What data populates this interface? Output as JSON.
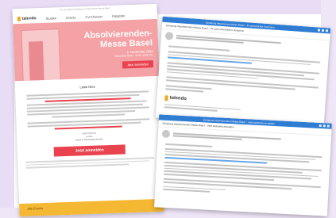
{
  "newsletter": {
    "preheader": "Ihre persönliche Einladung zur Absolventen-Messe Basel",
    "brand": "talendo",
    "nav": [
      "Studien",
      "Events",
      "CV-Checker",
      "Ratgeber"
    ],
    "hero": {
      "title_line1": "Absolvierenden-",
      "title_line2": "Messe Basel",
      "date": "8. November 2024",
      "subtitle": "Messeplatz Basel · 10:00–16:00 Uhr",
      "button": "Jetzt anmelden"
    },
    "greeting": "Liebe Nina",
    "signature": [
      "Liebe Grüsse",
      "Louise",
      "Head of Marketing talendo"
    ],
    "cta_button": "Jetzt anmelden",
    "footer_strip": "Alle Events"
  },
  "email_window_1": {
    "title": "Einladung Absolventen-Messe Basel – Ihr persönlicher Gutschein",
    "subject": "Einladung Absolvierenden-Messe Basel – Ihr ganz persönlicher Gutschein",
    "brand": "talendo"
  },
  "email_window_2": {
    "title": "Einladung Absolvierenden-Messe Basel – Jetzt kostenlos anmelden",
    "subject": "Einladung Absolvierenden-Messe Basel – Jetzt kostenlos anmelden"
  },
  "colors": {
    "accent_red": "#e8434e",
    "hero_pink": "#f4a2a6",
    "brand_yellow": "#f5a623",
    "window_blue": "#2f7cd3"
  },
  "icons": [
    "talendo-logo-icon",
    "avatar-icon",
    "window-close-icon"
  ]
}
